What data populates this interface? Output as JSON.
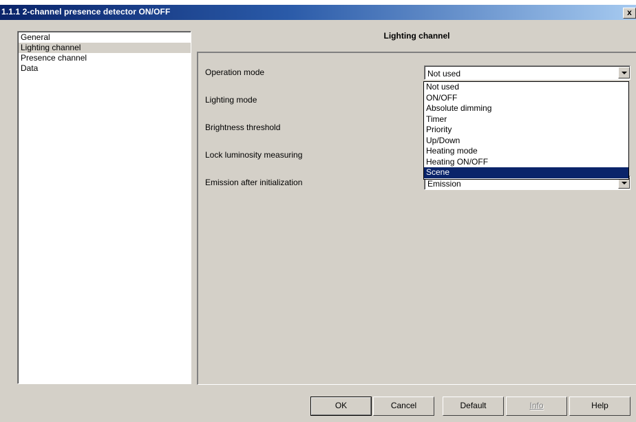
{
  "window": {
    "title": "1.1.1 2-channel presence detector ON/OFF",
    "close_label": "x"
  },
  "sidebar": {
    "items": [
      {
        "label": "General"
      },
      {
        "label": "Lighting channel",
        "selected": true
      },
      {
        "label": "Presence channel"
      },
      {
        "label": "Data"
      }
    ]
  },
  "main": {
    "title": "Lighting channel",
    "params": [
      {
        "label": "Operation mode"
      },
      {
        "label": "Lighting mode"
      },
      {
        "label": "Brightness threshold"
      },
      {
        "label": "Lock luminosity measuring"
      },
      {
        "label": "Emission after initialization"
      }
    ],
    "operation_mode_value": "Not used",
    "emission_value": "Emission",
    "dropdown_options": [
      "Not used",
      "ON/OFF",
      "Absolute dimming",
      "Timer",
      "Priority",
      "Up/Down",
      "Heating mode",
      "Heating ON/OFF",
      "Scene"
    ],
    "dropdown_highlighted": "Scene"
  },
  "buttons": {
    "ok": "OK",
    "cancel": "Cancel",
    "default": "Default",
    "info": "Info",
    "help": "Help"
  },
  "colors": {
    "title_gradient_start": "#0a246a",
    "title_gradient_end": "#a6caf0",
    "face": "#d4d0c8",
    "highlight": "#0a246a"
  }
}
